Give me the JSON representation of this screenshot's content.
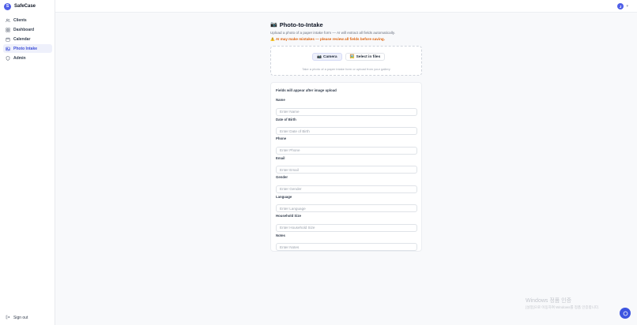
{
  "app": {
    "brand_initial": "S",
    "brand_name": "SafeCase"
  },
  "sidebar": {
    "items": [
      {
        "label": "Clients",
        "icon": "users-icon",
        "active": false
      },
      {
        "label": "Dashboard",
        "icon": "grid-icon",
        "active": false
      },
      {
        "label": "Calendar",
        "icon": "calendar-icon",
        "active": false
      },
      {
        "label": "Photo Intake",
        "icon": "image-icon",
        "active": true
      },
      {
        "label": "Admin",
        "icon": "shield-icon",
        "active": false
      }
    ],
    "signout_label": "Sign out"
  },
  "topbar": {
    "avatar_initial": "J"
  },
  "page": {
    "title_icon": "📷",
    "title": "Photo-to-Intake",
    "subtitle": "Upload a photo of a paper intake form — AI will extract all fields automatically.",
    "warning_icon": "⚠️",
    "warning": "AI may make mistakes — please review all fields before saving."
  },
  "upload": {
    "camera_icon": "📷",
    "camera_label": "Camera",
    "files_icon": "🖼️",
    "files_label": "Select in files",
    "hint": "Take a photo of a paper intake form or upload from your gallery"
  },
  "form": {
    "note": "Fields will appear after image upload",
    "fields": [
      {
        "label": "Name",
        "placeholder": "Enter Name",
        "value": ""
      },
      {
        "label": "Date of Birth",
        "placeholder": "Enter Date of Birth",
        "value": ""
      },
      {
        "label": "Phone",
        "placeholder": "Enter Phone",
        "value": ""
      },
      {
        "label": "Email",
        "placeholder": "Enter Email",
        "value": ""
      },
      {
        "label": "Gender",
        "placeholder": "Enter Gender",
        "value": ""
      },
      {
        "label": "Language",
        "placeholder": "Enter Language",
        "value": ""
      },
      {
        "label": "Household Size",
        "placeholder": "Enter Household Size",
        "value": ""
      },
      {
        "label": "Notes",
        "placeholder": "Enter Notes",
        "value": ""
      }
    ]
  },
  "watermark": {
    "title": "Windows 정품 인증",
    "subtitle": "[설정]으로 이동하여 Windows를 정품 인증합니다."
  },
  "colors": {
    "accent": "#4f5fe8",
    "warning": "#e0630b",
    "active_bg": "#eef0fb"
  }
}
